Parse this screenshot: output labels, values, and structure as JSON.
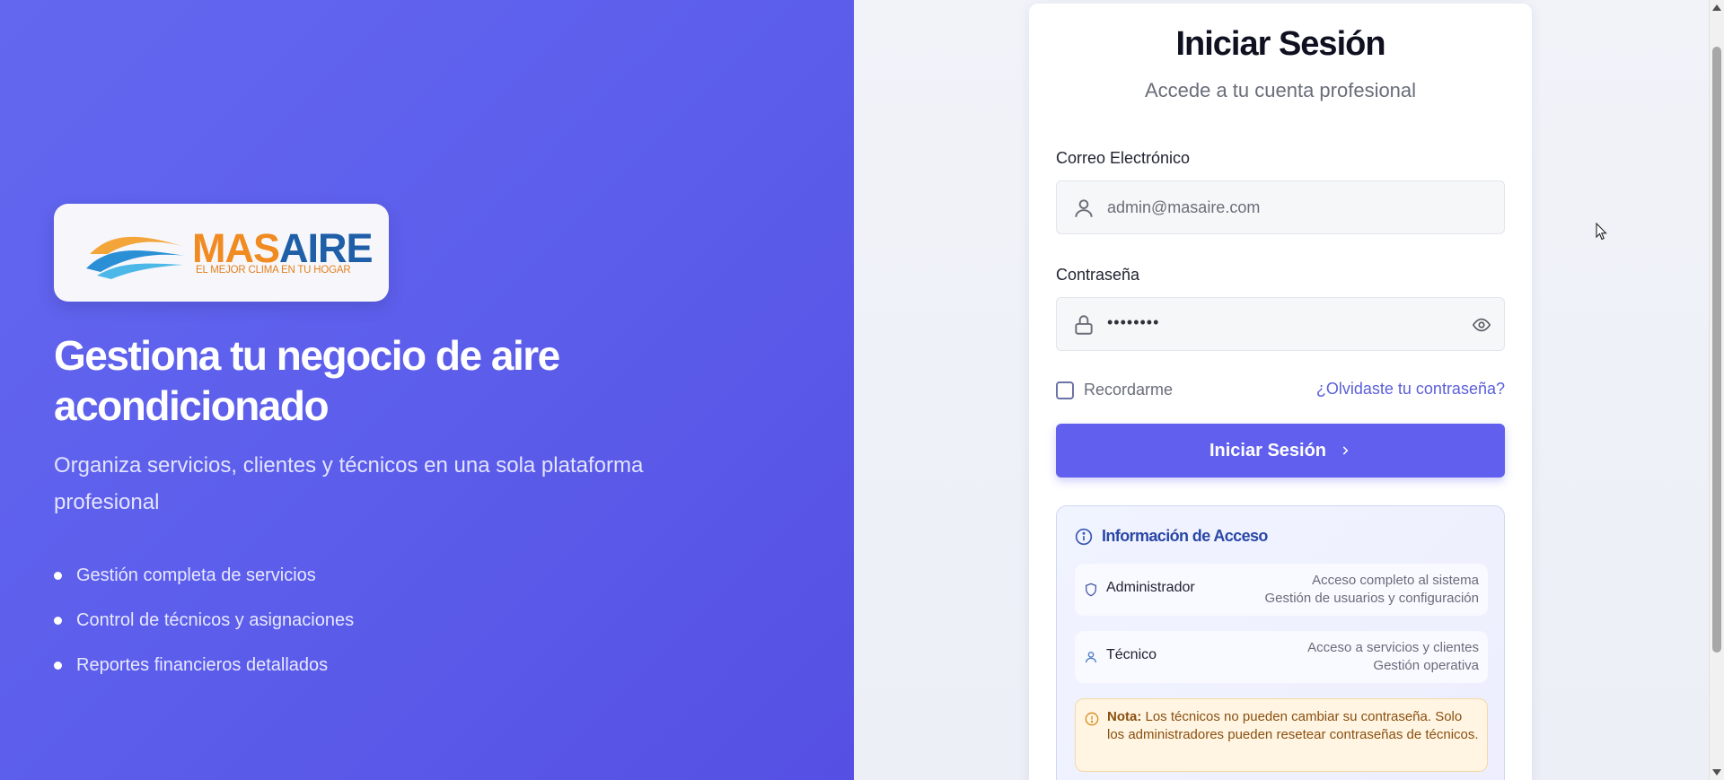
{
  "hero": {
    "logo": {
      "brand_a": "MAS",
      "brand_b": "AIRE",
      "tagline": "EL MEJOR CLIMA EN TU HOGAR"
    },
    "title": "Gestiona tu negocio de aire acondicionado",
    "subtitle": "Organiza servicios, clientes y técnicos en una sola plataforma profesional",
    "features": [
      "Gestión completa de servicios",
      "Control de técnicos y asignaciones",
      "Reportes financieros detallados"
    ]
  },
  "login": {
    "title": "Iniciar Sesión",
    "subtitle": "Accede a tu cuenta profesional",
    "email_label": "Correo Electrónico",
    "email_value": "admin@masaire.com",
    "password_label": "Contraseña",
    "password_value": "••••••••",
    "remember_label": "Recordarme",
    "forgot_link": "¿Olvidaste tu contraseña?",
    "submit_label": "Iniciar Sesión"
  },
  "access_info": {
    "title": "Información de Acceso",
    "roles": [
      {
        "name": "Administrador",
        "desc_1": "Acceso completo al sistema",
        "desc_2": "Gestión de usuarios y configuración"
      },
      {
        "name": "Técnico",
        "desc_1": "Acceso a servicios y clientes",
        "desc_2": "Gestión operativa"
      }
    ],
    "note_label": "Nota:",
    "note_text": "Los técnicos no pueden cambiar su contraseña. Solo los administradores pueden resetear contraseñas de técnicos."
  },
  "colors": {
    "primary": "#6160ee",
    "hero_bg": "#5d5fec",
    "info_title": "#2a47a6",
    "note_bg": "#fff5e2",
    "brand_orange": "#f08b22",
    "brand_blue": "#1f5fa8"
  },
  "icons": [
    "user-icon",
    "lock-icon",
    "eye-icon",
    "checkbox",
    "chevron-right-icon",
    "info-icon",
    "shield-icon",
    "person-icon",
    "warning-icon",
    "cursor-icon"
  ]
}
